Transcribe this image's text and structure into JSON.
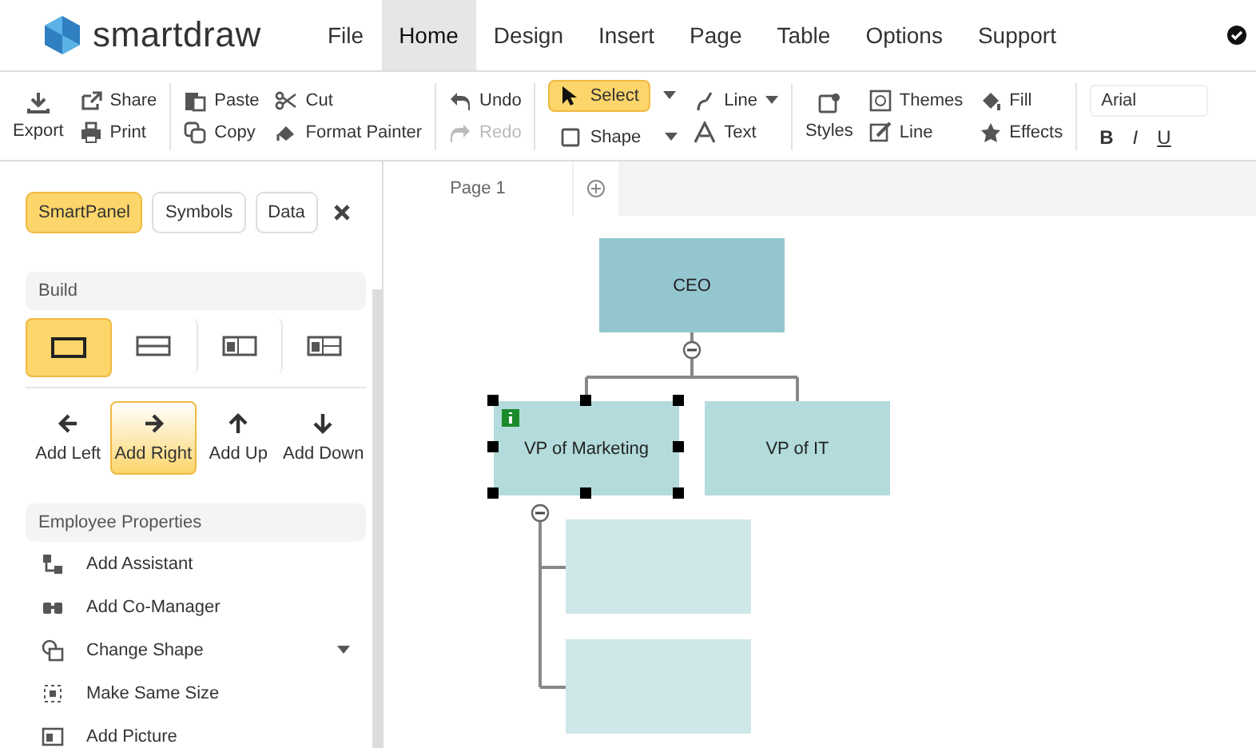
{
  "app": {
    "logo_text": "smartdraw"
  },
  "menu": [
    {
      "label": "File",
      "selected": false
    },
    {
      "label": "Home",
      "selected": true
    },
    {
      "label": "Design",
      "selected": false
    },
    {
      "label": "Insert",
      "selected": false
    },
    {
      "label": "Page",
      "selected": false
    },
    {
      "label": "Table",
      "selected": false
    },
    {
      "label": "Options",
      "selected": false
    },
    {
      "label": "Support",
      "selected": false
    }
  ],
  "toolbar": {
    "export": "Export",
    "groups": [
      [
        {
          "label": "Share",
          "disabled": false
        },
        {
          "label": "Print",
          "disabled": false
        }
      ],
      [
        {
          "label": "Paste",
          "disabled": false
        },
        {
          "label": "Copy",
          "disabled": false
        }
      ],
      [
        {
          "label": "Cut",
          "disabled": false
        },
        {
          "label": "Format Painter",
          "disabled": false
        }
      ],
      [
        {
          "label": "Undo",
          "disabled": false
        },
        {
          "label": "Redo",
          "disabled": true
        }
      ]
    ],
    "tools": [
      {
        "label": "Select",
        "selected": true
      },
      {
        "label": "Shape",
        "selected": false
      }
    ],
    "tools2": [
      {
        "label": "Line",
        "dropdown": true
      },
      {
        "label": "Text",
        "dropdown": false
      }
    ],
    "styles": "Styles",
    "style_items": [
      [
        {
          "label": "Themes"
        },
        {
          "label": "Line"
        }
      ],
      [
        {
          "label": "Fill"
        },
        {
          "label": "Effects"
        }
      ]
    ],
    "font": "Arial",
    "format_buttons": [
      "B",
      "I",
      "U"
    ]
  },
  "sidebar": {
    "tabs": [
      {
        "label": "SmartPanel",
        "selected": true
      },
      {
        "label": "Symbols",
        "selected": false
      },
      {
        "label": "Data",
        "selected": false
      }
    ],
    "build_title": "Build",
    "shapes": [
      {
        "kind": "plain",
        "selected": true
      },
      {
        "kind": "split",
        "selected": false
      },
      {
        "kind": "photo",
        "selected": false
      },
      {
        "kind": "photo-split",
        "selected": false
      }
    ],
    "directions": [
      {
        "label": "Add Left",
        "selected": false
      },
      {
        "label": "Add Right",
        "selected": true
      },
      {
        "label": "Add Up",
        "selected": false
      },
      {
        "label": "Add Down",
        "selected": false
      }
    ],
    "properties_title": "Employee Properties",
    "properties": [
      {
        "label": "Add Assistant",
        "dropdown": false
      },
      {
        "label": "Add Co-Manager",
        "dropdown": false
      },
      {
        "label": "Change Shape",
        "dropdown": true
      },
      {
        "label": "Make Same Size",
        "dropdown": false
      },
      {
        "label": "Add Picture",
        "dropdown": false
      }
    ]
  },
  "pages": [
    {
      "label": "Page 1",
      "selected": true
    }
  ],
  "nodes": [
    {
      "label": "CEO",
      "selected": false,
      "color": "#94c6cf"
    },
    {
      "label": "VP of Marketing",
      "selected": true,
      "color": "#b3dbdb"
    },
    {
      "label": "VP of IT",
      "selected": false,
      "color": "#b3dbdb"
    },
    {
      "selected": false,
      "color": "#cfe7e8"
    },
    {
      "selected": false,
      "color": "#cfe7e8"
    }
  ]
}
